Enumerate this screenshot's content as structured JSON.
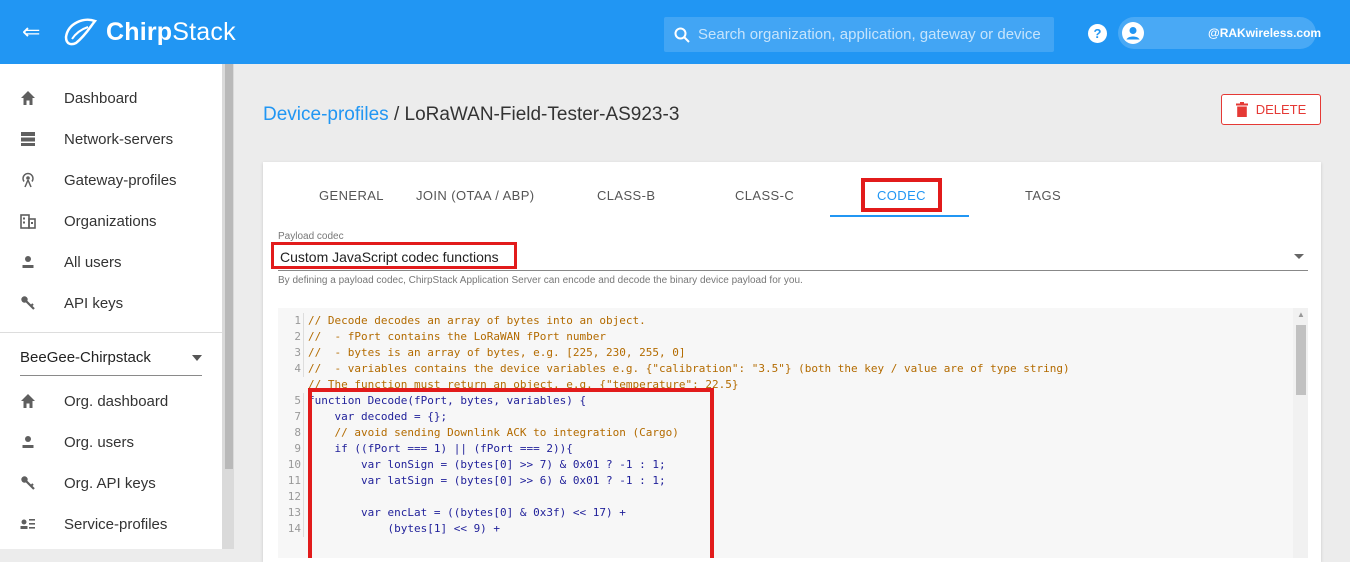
{
  "header": {
    "logo_prefix": "Chirp",
    "logo_suffix": "Stack",
    "search_placeholder": "Search organization, application, gateway or device",
    "user_label": "@RAKwireless.com"
  },
  "sidebar": {
    "items": [
      {
        "label": "Dashboard",
        "icon": "home-icon"
      },
      {
        "label": "Network-servers",
        "icon": "server-icon"
      },
      {
        "label": "Gateway-profiles",
        "icon": "radio-tower-icon"
      },
      {
        "label": "Organizations",
        "icon": "building-icon"
      },
      {
        "label": "All users",
        "icon": "user-icon"
      },
      {
        "label": "API keys",
        "icon": "key-icon"
      }
    ],
    "org_selector": "BeeGee-Chirpstack",
    "org_items": [
      {
        "label": "Org. dashboard",
        "icon": "home-icon"
      },
      {
        "label": "Org. users",
        "icon": "user-icon"
      },
      {
        "label": "Org. API keys",
        "icon": "key-icon"
      },
      {
        "label": "Service-profiles",
        "icon": "service-profiles-icon"
      }
    ]
  },
  "breadcrumb": {
    "parent": "Device-profiles",
    "separator": "/",
    "current": "LoRaWAN-Field-Tester-AS923-3"
  },
  "actions": {
    "delete_label": "DELETE"
  },
  "tabs": [
    {
      "label": "GENERAL",
      "active": false
    },
    {
      "label": "JOIN (OTAA / ABP)",
      "active": false
    },
    {
      "label": "CLASS-B",
      "active": false
    },
    {
      "label": "CLASS-C",
      "active": false
    },
    {
      "label": "CODEC",
      "active": true
    },
    {
      "label": "TAGS",
      "active": false
    }
  ],
  "payload_codec": {
    "label": "Payload codec",
    "value": "Custom JavaScript codec functions",
    "helper": "By defining a payload codec, ChirpStack Application Server can encode and decode the binary device payload for you."
  },
  "code": {
    "lines": [
      {
        "no": "1",
        "text": "// Decode decodes an array of bytes into an object.",
        "comment": true
      },
      {
        "no": "2",
        "text": "//  - fPort contains the LoRaWAN fPort number",
        "comment": true
      },
      {
        "no": "3",
        "text": "//  - bytes is an array of bytes, e.g. [225, 230, 255, 0]",
        "comment": true
      },
      {
        "no": "4",
        "text": "//  - variables contains the device variables e.g. {\"calibration\": \"3.5\"} (both the key / value are of type string)",
        "comment": true
      },
      {
        "no": "",
        "text": "// The function must return an object, e.g. {\"temperature\": 22.5}",
        "comment": true
      },
      {
        "no": "5",
        "text": "function Decode(fPort, bytes, variables) {",
        "comment": false
      },
      {
        "no": "7",
        "text": "    var decoded = {};",
        "comment": false
      },
      {
        "no": "8",
        "text": "    // avoid sending Downlink ACK to integration (Cargo)",
        "comment": true
      },
      {
        "no": "9",
        "text": "    if ((fPort === 1) || (fPort === 2)){",
        "comment": false
      },
      {
        "no": "10",
        "text": "        var lonSign = (bytes[0] >> 7) & 0x01 ? -1 : 1;",
        "comment": false
      },
      {
        "no": "11",
        "text": "        var latSign = (bytes[0] >> 6) & 0x01 ? -1 : 1;",
        "comment": false
      },
      {
        "no": "12",
        "text": "",
        "comment": false
      },
      {
        "no": "13",
        "text": "        var encLat = ((bytes[0] & 0x3f) << 17) +",
        "comment": false
      },
      {
        "no": "14",
        "text": "            (bytes[1] << 9) +",
        "comment": false
      }
    ]
  },
  "colors": {
    "primary": "#2196f3",
    "danger": "#e53935",
    "highlight": "#e21b1b"
  }
}
